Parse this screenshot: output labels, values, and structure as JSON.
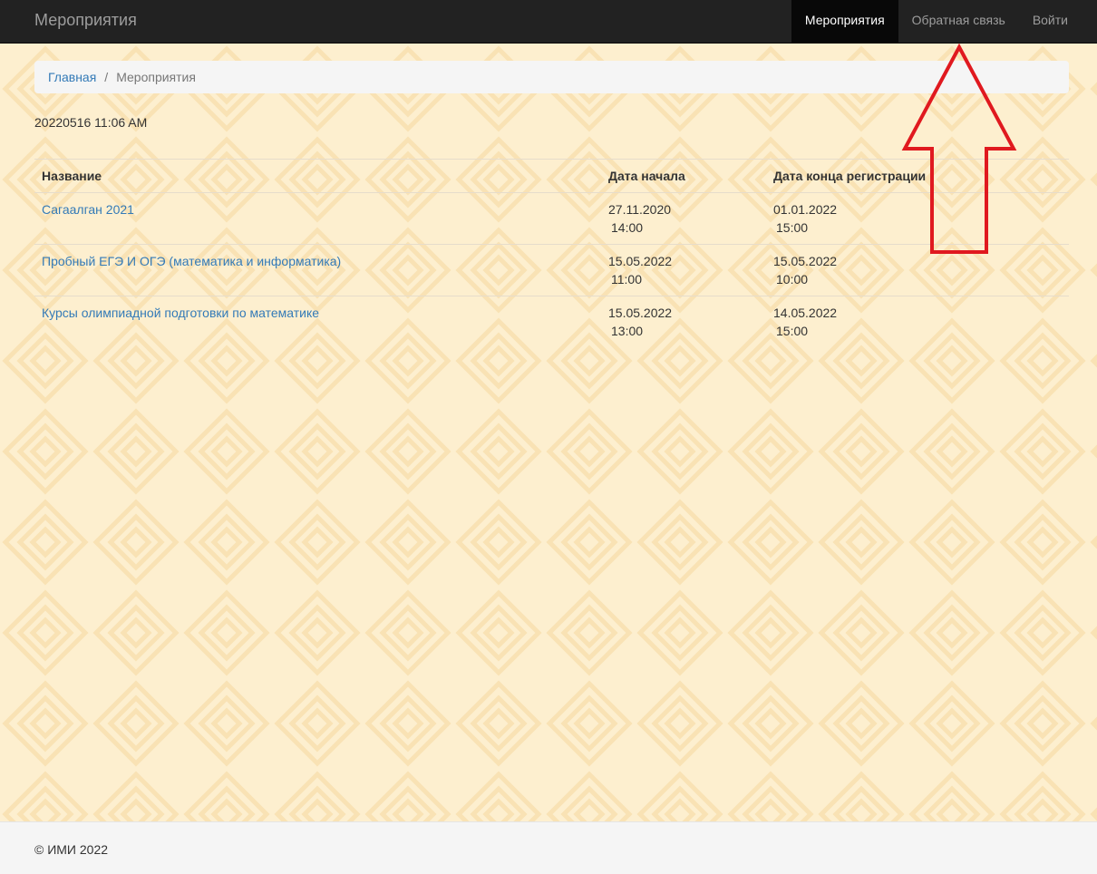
{
  "navbar": {
    "brand": "Мероприятия",
    "items": [
      {
        "label": "Мероприятия",
        "active": true
      },
      {
        "label": "Обратная связь",
        "active": false
      },
      {
        "label": "Войти",
        "active": false
      }
    ]
  },
  "breadcrumb": {
    "home": "Главная",
    "separator": "/",
    "current": "Мероприятия"
  },
  "timestamp": "20220516 11:06 AM",
  "table": {
    "headers": [
      "Название",
      "Дата начала",
      "Дата конца регистрации"
    ],
    "rows": [
      {
        "name": "Сагаалган 2021",
        "start_date": "27.11.2020",
        "start_time": "14:00",
        "reg_end_date": "01.01.2022",
        "reg_end_time": "15:00"
      },
      {
        "name": "Пробный ЕГЭ И ОГЭ (математика и информатика)",
        "start_date": "15.05.2022",
        "start_time": "11:00",
        "reg_end_date": "15.05.2022",
        "reg_end_time": "10:00"
      },
      {
        "name": "Курсы олимпиадной подготовки по математике",
        "start_date": "15.05.2022",
        "start_time": "13:00",
        "reg_end_date": "14.05.2022",
        "reg_end_time": "15:00"
      }
    ]
  },
  "footer": {
    "text": "© ИМИ 2022"
  },
  "colors": {
    "navbar_bg": "#222222",
    "link": "#337ab7",
    "page_bg": "#fdefcf",
    "annotation_arrow": "#e0191f"
  },
  "annotation": {
    "icon": "up-arrow-icon"
  }
}
